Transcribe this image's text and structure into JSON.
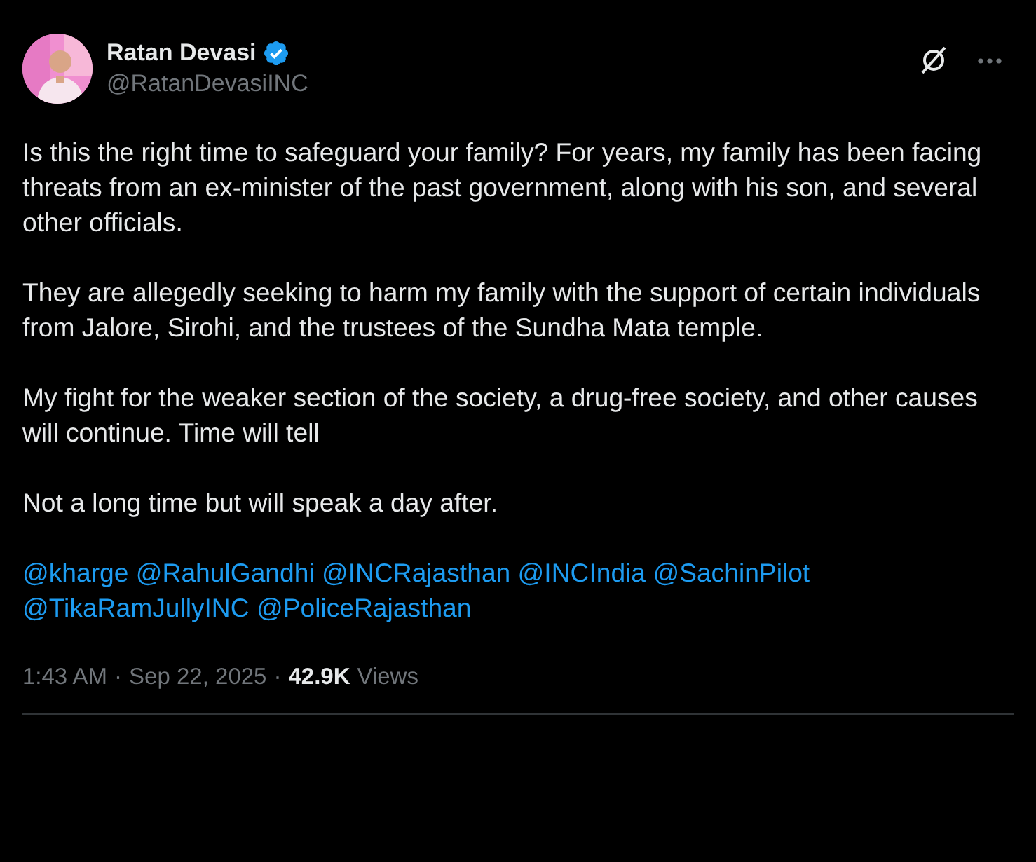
{
  "author": {
    "name": "Ratan Devasi",
    "verified": true,
    "handle": "@RatanDevasiINC"
  },
  "paragraphs": [
    "Is this the right time to safeguard your family? For years, my family has been facing threats from an ex-minister of the past government, along with his son, and several other officials.",
    "They are allegedly seeking to harm my family with the support of certain individuals from Jalore, Sirohi, and the trustees of the Sundha Mata temple.",
    "My fight for the weaker section of the society, a drug-free society, and other causes will continue. Time will tell",
    "Not a long time but will speak a day after."
  ],
  "mentions": [
    "@kharge",
    "@RahulGandhi",
    "@INCRajasthan",
    "@INCIndia",
    "@SachinPilot",
    "@TikaRamJullyINC",
    "@PoliceRajasthan"
  ],
  "meta": {
    "time": "1:43 AM",
    "separator": "·",
    "date": "Sep 22, 2025",
    "views_count": "42.9K",
    "views_label": "Views"
  }
}
